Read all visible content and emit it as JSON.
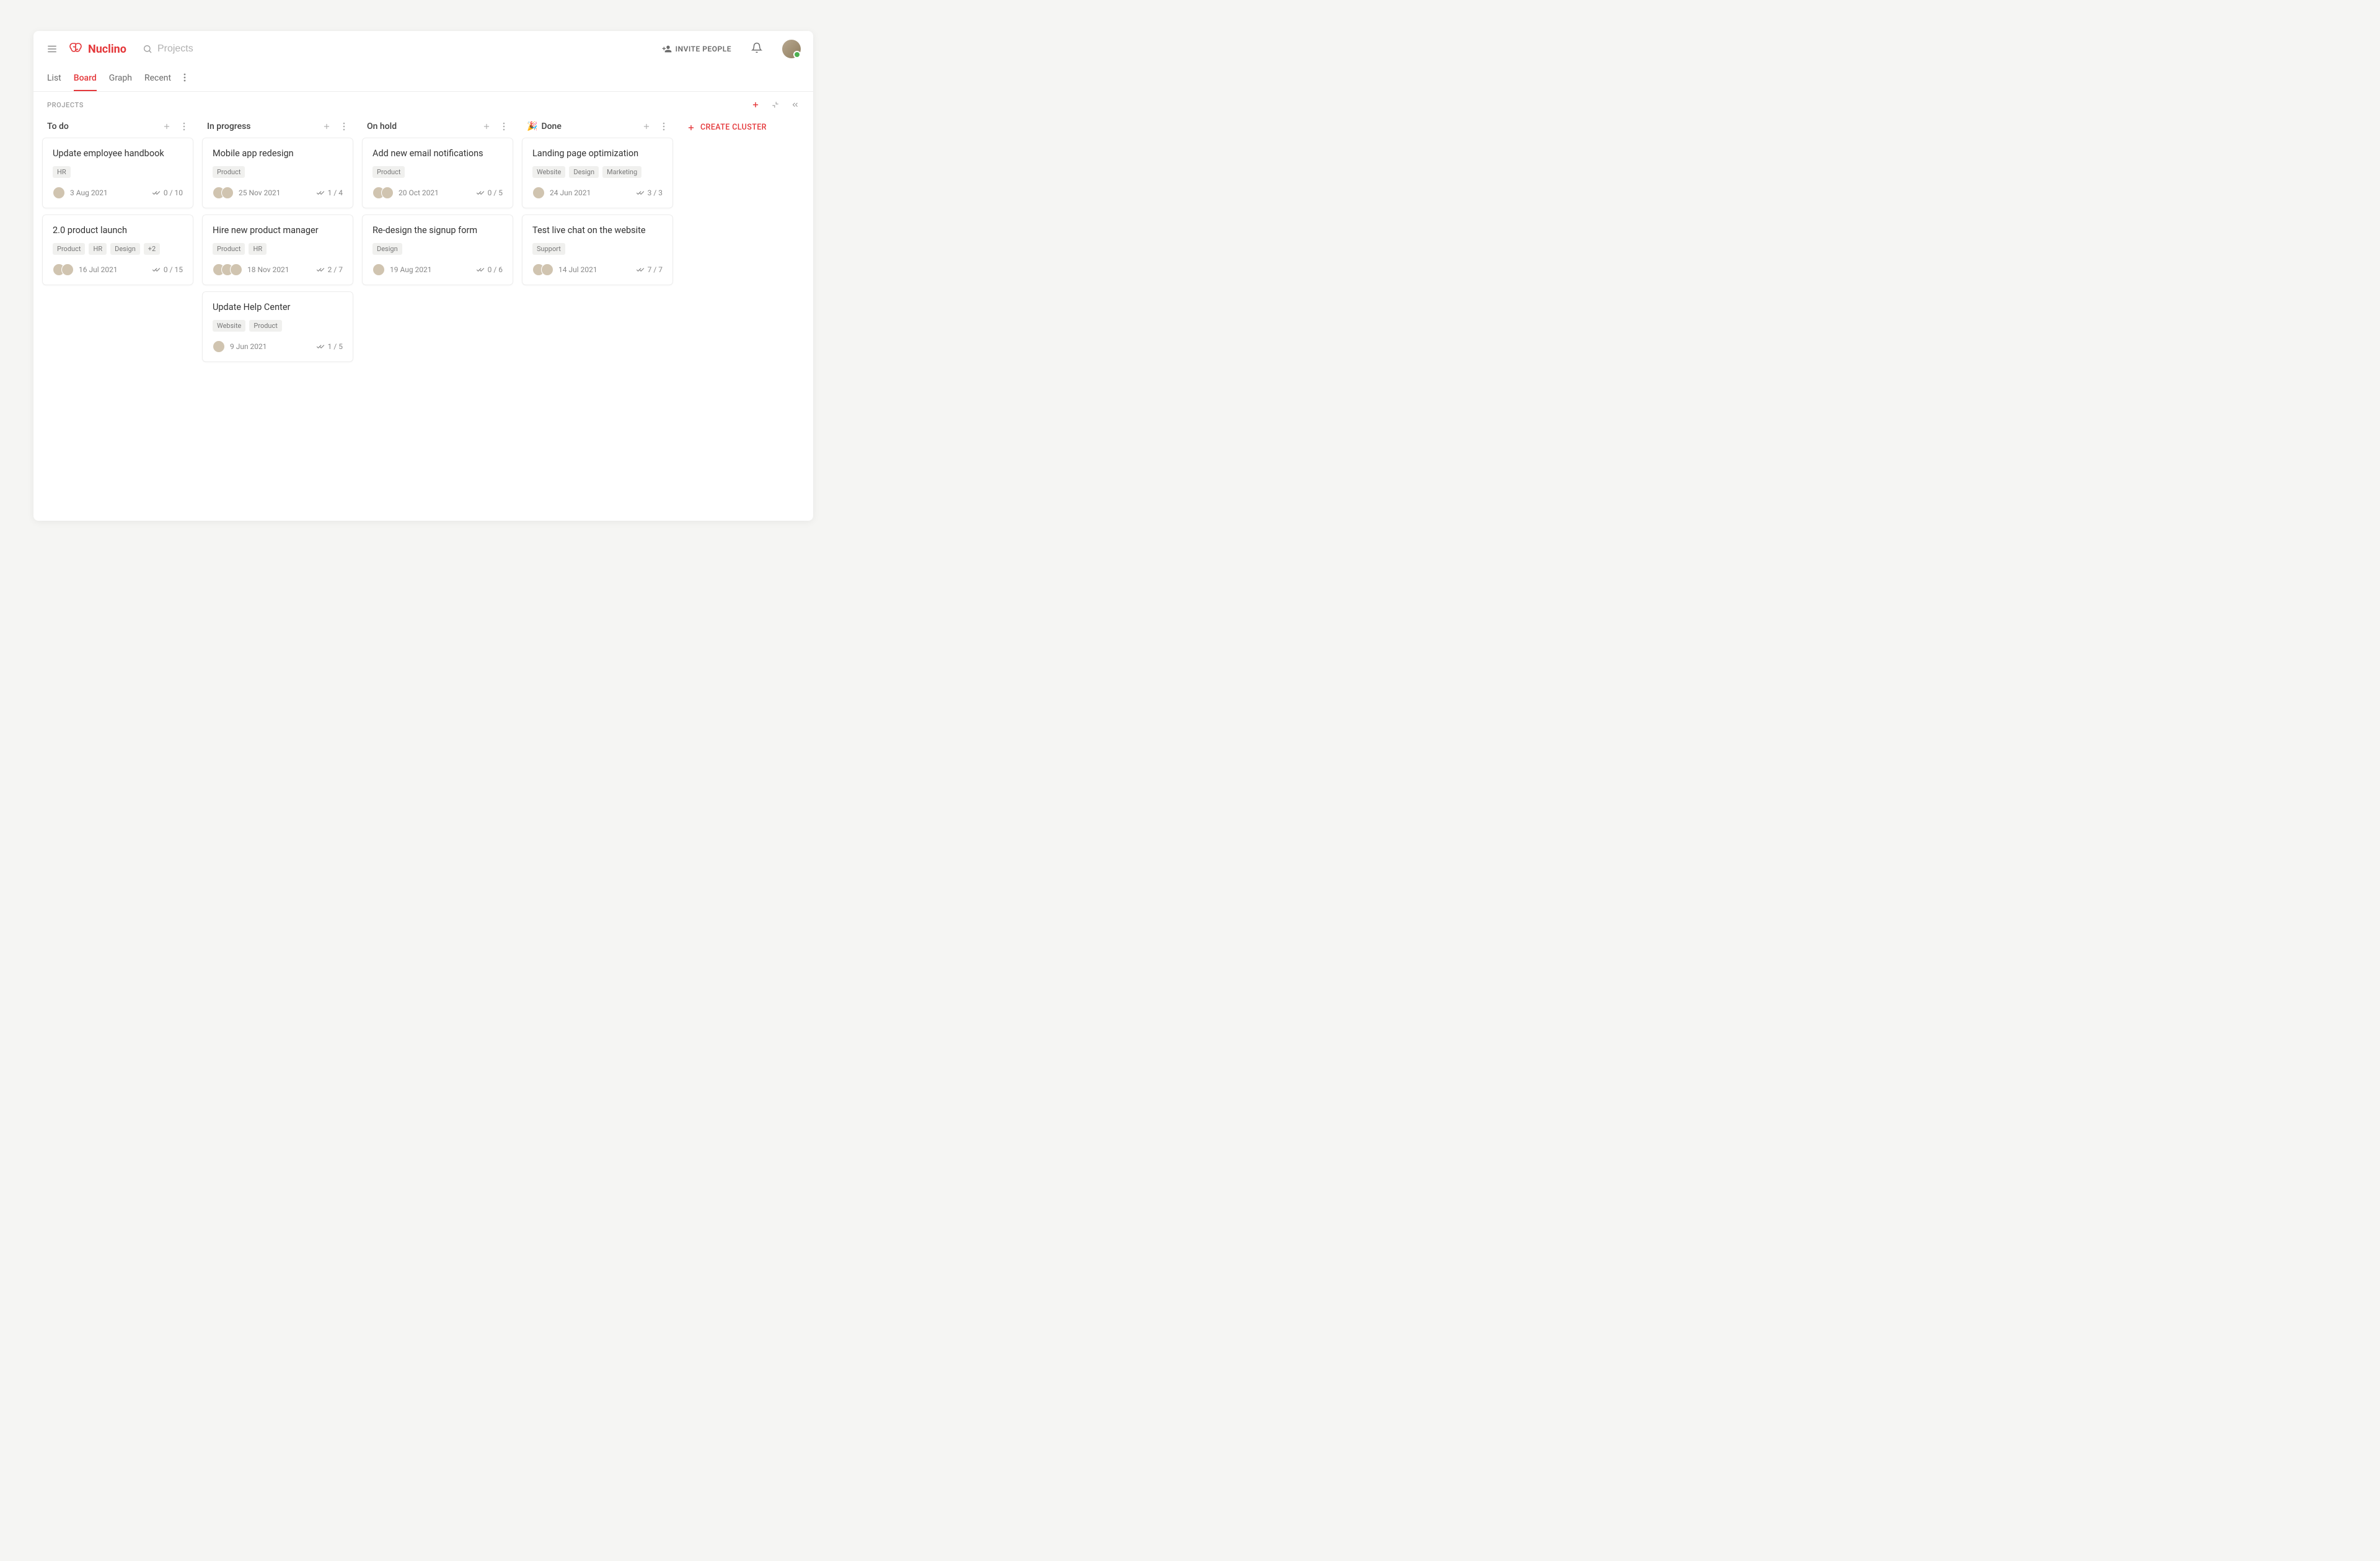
{
  "header": {
    "logo_text": "Nuclino",
    "search_placeholder": "Projects",
    "invite_label": "INVITE PEOPLE"
  },
  "tabs": {
    "list": "List",
    "board": "Board",
    "graph": "Graph",
    "recent": "Recent"
  },
  "breadcrumb": "PROJECTS",
  "create_cluster_label": "CREATE CLUSTER",
  "columns": [
    {
      "title": "To do",
      "emoji": "",
      "cards": [
        {
          "title": "Update employee handbook",
          "tags": [
            "HR"
          ],
          "avatars": [
            "av1"
          ],
          "date": "3 Aug 2021",
          "progress": "0 / 10"
        },
        {
          "title": "2.0 product launch",
          "tags": [
            "Product",
            "HR",
            "Design",
            "+2"
          ],
          "avatars": [
            "av1",
            "av2"
          ],
          "date": "16 Jul 2021",
          "progress": "0 / 15"
        }
      ]
    },
    {
      "title": "In progress",
      "emoji": "",
      "cards": [
        {
          "title": "Mobile app redesign",
          "tags": [
            "Product"
          ],
          "avatars": [
            "av1",
            "av3"
          ],
          "date": "25 Nov 2021",
          "progress": "1 / 4"
        },
        {
          "title": "Hire new product manager",
          "tags": [
            "Product",
            "HR"
          ],
          "avatars": [
            "av3",
            "av4",
            "av6"
          ],
          "date": "18 Nov 2021",
          "progress": "2 / 7"
        },
        {
          "title": "Update Help Center",
          "tags": [
            "Website",
            "Product"
          ],
          "avatars": [
            "av5"
          ],
          "date": "9 Jun 2021",
          "progress": "1 / 5"
        }
      ]
    },
    {
      "title": "On hold",
      "emoji": "",
      "cards": [
        {
          "title": "Add new email notifications",
          "tags": [
            "Product"
          ],
          "avatars": [
            "av1",
            "av6"
          ],
          "date": "20 Oct 2021",
          "progress": "0 / 5"
        },
        {
          "title": "Re-design the signup form",
          "tags": [
            "Design"
          ],
          "avatars": [
            "av1"
          ],
          "date": "19 Aug 2021",
          "progress": "0 / 6"
        }
      ]
    },
    {
      "title": "Done",
      "emoji": "🎉",
      "cards": [
        {
          "title": "Landing page optimization",
          "tags": [
            "Website",
            "Design",
            "Marketing"
          ],
          "avatars": [
            "av5"
          ],
          "date": "24 Jun 2021",
          "progress": "3 / 3"
        },
        {
          "title": "Test live chat on the website",
          "tags": [
            "Support"
          ],
          "avatars": [
            "av5",
            "av6"
          ],
          "date": "14 Jul 2021",
          "progress": "7 / 7"
        }
      ]
    }
  ]
}
